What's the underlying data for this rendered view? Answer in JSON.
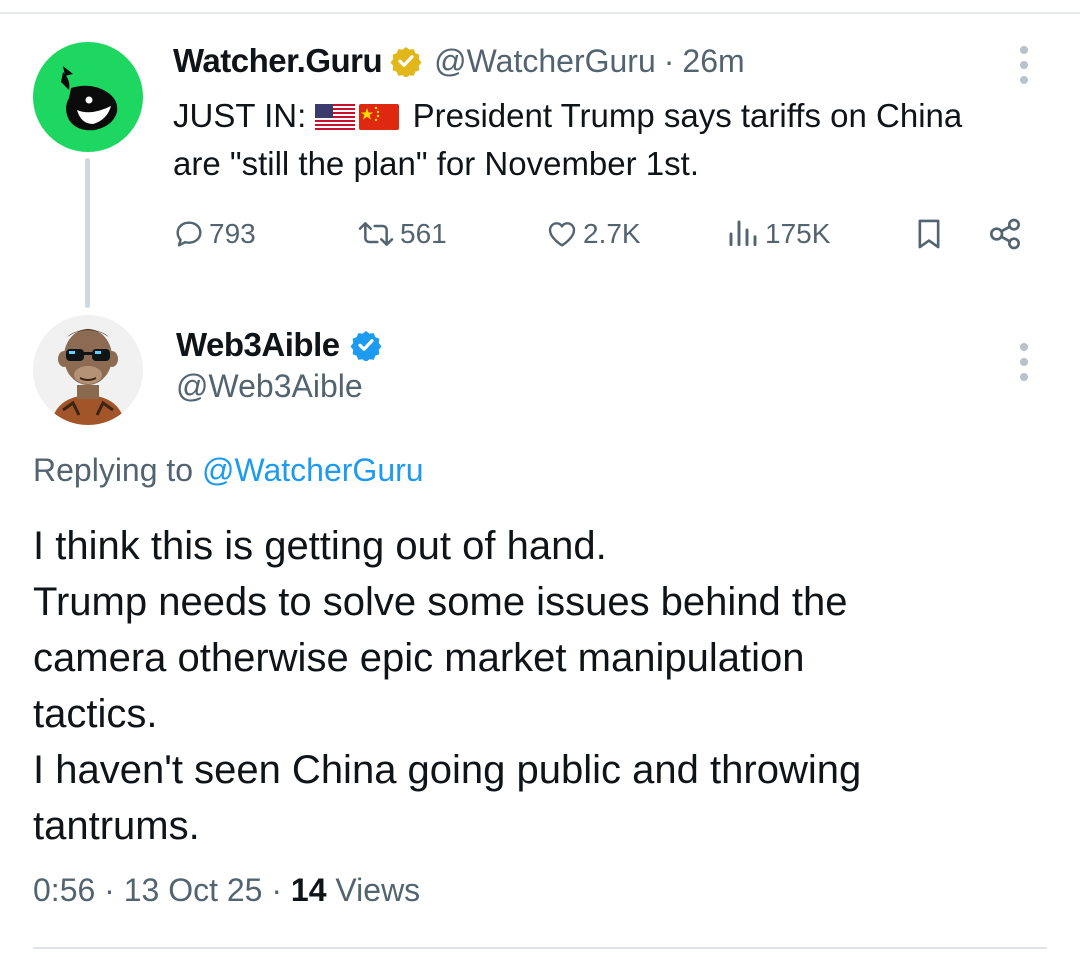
{
  "parent_tweet": {
    "author_name": "Watcher.Guru",
    "handle": "@WatcherGuru",
    "separator": "·",
    "time": "26m",
    "text_prefix": "JUST IN: ",
    "flags": [
      "us-flag",
      "china-flag"
    ],
    "text_line1_rest": " President Trump says tariffs on China",
    "text_line2": "are \"still the plan\" for November 1st.",
    "actions": {
      "replies": "793",
      "reposts": "561",
      "likes": "2.7K",
      "views": "175K"
    },
    "icons": [
      "reply-icon",
      "repost-icon",
      "like-icon",
      "views-icon",
      "bookmark-icon",
      "share-icon"
    ],
    "verified_badge_color": "#e2b719",
    "avatar_color": "#1ed760"
  },
  "reply_tweet": {
    "author_name": "Web3Aible",
    "handle": "@Web3Aible",
    "verified_badge_color": "#1d9bf0",
    "replying_prefix": "Replying to ",
    "replying_handle": "@WatcherGuru",
    "text_lines": [
      "I think this is getting out of hand.",
      "Trump needs to solve some issues behind the",
      "camera otherwise epic market manipulation",
      "tactics.",
      "I haven't seen China going public and throwing",
      "tantrums."
    ],
    "timestamp": "0:56",
    "date": "13 Oct 25",
    "separator": "·",
    "views_count": "14",
    "views_label": " Views"
  }
}
